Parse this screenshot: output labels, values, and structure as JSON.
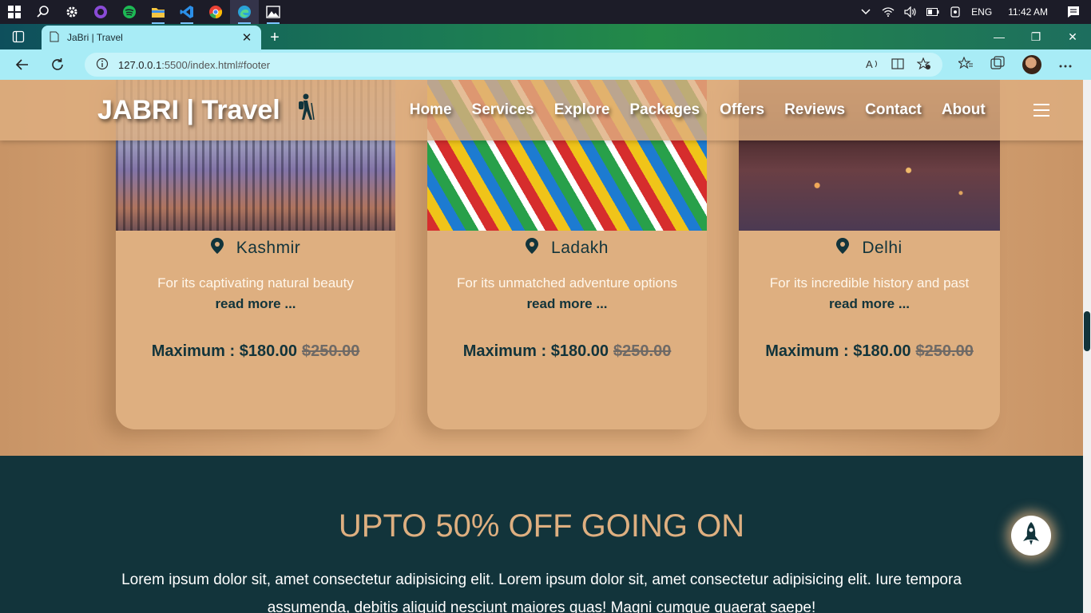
{
  "taskbar": {
    "apps": [
      {
        "name": "windows-start-icon"
      },
      {
        "name": "search-icon"
      },
      {
        "name": "settings-icon"
      },
      {
        "name": "github-icon"
      },
      {
        "name": "spotify-icon"
      },
      {
        "name": "file-explorer-icon"
      },
      {
        "name": "vscode-icon"
      },
      {
        "name": "chrome-icon"
      },
      {
        "name": "edge-icon"
      },
      {
        "name": "photos-icon"
      }
    ],
    "language": "ENG",
    "time": "11:42 AM"
  },
  "browser": {
    "tab_title": "JaBri | Travel",
    "url_host": "127.0.0.1",
    "url_rest": ":5500/index.html#footer"
  },
  "header": {
    "logo": "JABRI | Travel",
    "nav": [
      "Home",
      "Services",
      "Explore",
      "Packages",
      "Offers",
      "Reviews",
      "Contact",
      "About"
    ]
  },
  "packages": [
    {
      "place": "Kashmir",
      "desc": "For its captivating natural beauty",
      "more": "read more ...",
      "price_label": "Maximum : $180.00",
      "old_price": "$250.00"
    },
    {
      "place": "Ladakh",
      "desc": "For its unmatched adventure options",
      "more": "read more ...",
      "price_label": "Maximum : $180.00",
      "old_price": "$250.00"
    },
    {
      "place": "Delhi",
      "desc": "For its incredible history and past",
      "more": "read more ...",
      "price_label": "Maximum : $180.00",
      "old_price": "$250.00"
    }
  ],
  "offer": {
    "title": "UPTO 50% OFF GOING ON",
    "text": "Lorem ipsum dolor sit, amet consectetur adipisicing elit. Lorem ipsum dolor sit, amet consectetur adipisicing elit. Iure tempora assumenda, debitis aliquid nesciunt maiores quas! Magni cumque quaerat saepe!"
  },
  "colors": {
    "brand_dark": "#12343b",
    "brand_tan": "#deaf80"
  }
}
